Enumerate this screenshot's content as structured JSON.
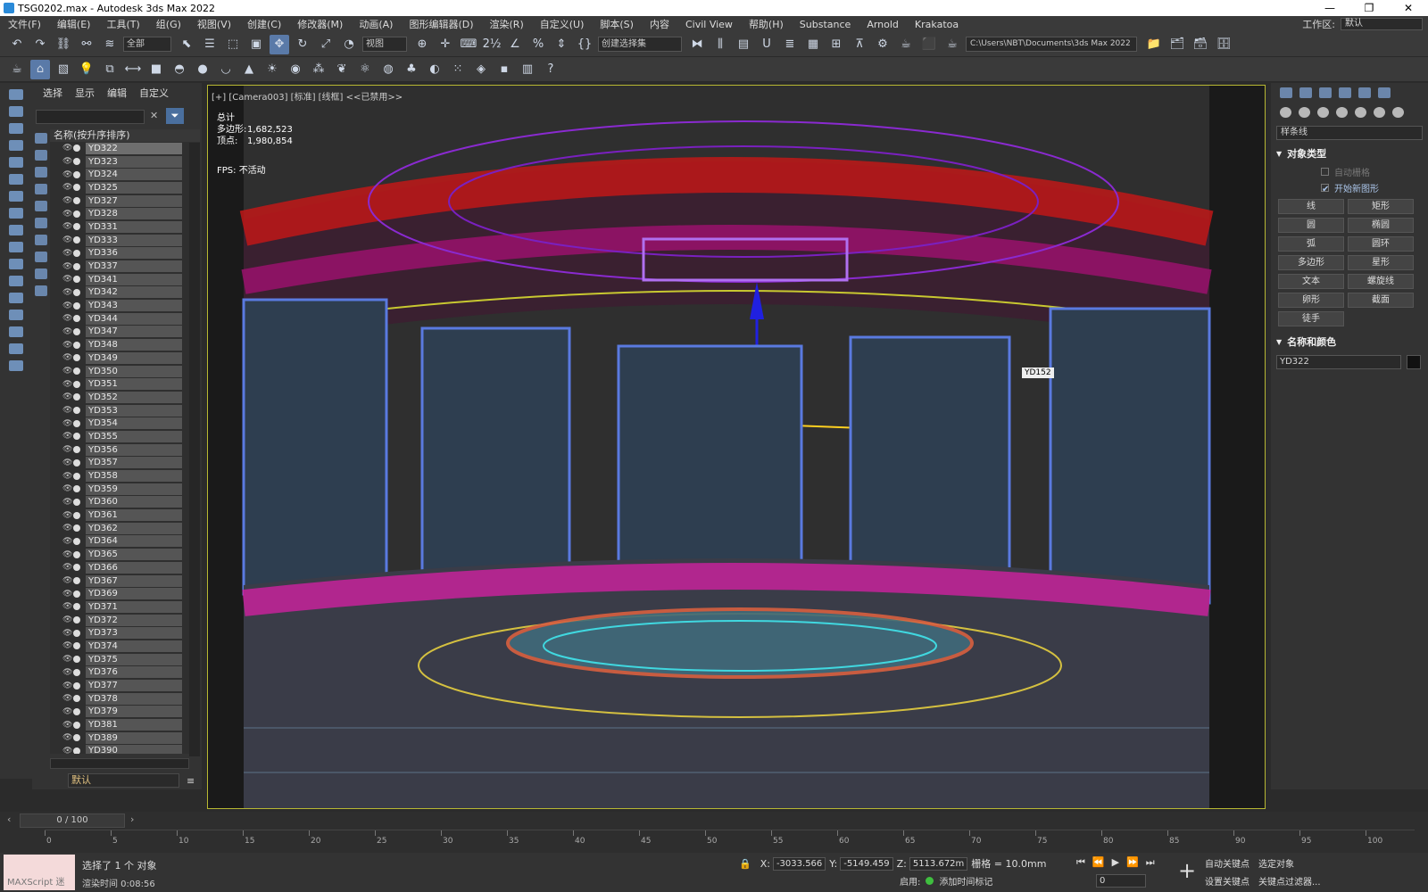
{
  "window": {
    "title": "TSG0202.max - Autodesk 3ds Max 2022",
    "minimize": "—",
    "restore": "❐",
    "close": "✕"
  },
  "menu": {
    "items": [
      "文件(F)",
      "编辑(E)",
      "工具(T)",
      "组(G)",
      "视图(V)",
      "创建(C)",
      "修改器(M)",
      "动画(A)",
      "图形编辑器(D)",
      "渲染(R)",
      "自定义(U)",
      "脚本(S)",
      "内容",
      "Civil View",
      "帮助(H)",
      "Substance",
      "Arnold",
      "Krakatoa"
    ],
    "workspace_label": "工作区:",
    "workspace_value": "默认"
  },
  "toolbar": {
    "selection_filter": "全部",
    "ref_coord": "视图",
    "named_selection": "创建选择集",
    "project_path": "C:\\Users\\NBT\\Documents\\3ds Max 2022"
  },
  "scene_explorer": {
    "tabs": [
      "选择",
      "显示",
      "编辑",
      "自定义"
    ],
    "column_header": "名称(按升序排序)",
    "items": [
      "YD322",
      "YD323",
      "YD324",
      "YD325",
      "YD327",
      "YD328",
      "YD331",
      "YD333",
      "YD336",
      "YD337",
      "YD341",
      "YD342",
      "YD343",
      "YD344",
      "YD347",
      "YD348",
      "YD349",
      "YD350",
      "YD351",
      "YD352",
      "YD353",
      "YD354",
      "YD355",
      "YD356",
      "YD357",
      "YD358",
      "YD359",
      "YD360",
      "YD361",
      "YD362",
      "YD364",
      "YD365",
      "YD366",
      "YD367",
      "YD369",
      "YD371",
      "YD372",
      "YD373",
      "YD374",
      "YD375",
      "YD376",
      "YD377",
      "YD378",
      "YD379",
      "YD381",
      "YD389",
      "YD390"
    ],
    "layer": "默认"
  },
  "viewport": {
    "label": "[+] [Camera003] [标准] [线框] <<已禁用>>",
    "stats_title": "总计",
    "polys_label": "多边形:",
    "polys_value": "1,682,523",
    "verts_label": "顶点:",
    "verts_value": "1,980,854",
    "fps_label": "FPS:",
    "fps_value": "不活动",
    "object_tag": "YD152"
  },
  "command_panel": {
    "category": "样条线",
    "object_type_title": "对象类型",
    "auto_grid": "自动栅格",
    "start_new_shape": "开始新图形",
    "buttons": [
      "线",
      "矩形",
      "圆",
      "椭圆",
      "弧",
      "圆环",
      "多边形",
      "星形",
      "文本",
      "螺旋线",
      "卵形",
      "截面",
      "徒手"
    ],
    "name_color_title": "名称和颜色",
    "object_name": "YD322"
  },
  "timeline": {
    "slider": "0 / 100",
    "ticks": [
      0,
      5,
      10,
      15,
      20,
      25,
      30,
      35,
      40,
      45,
      50,
      55,
      60,
      65,
      70,
      75,
      80,
      85,
      90,
      95,
      100
    ]
  },
  "status": {
    "maxscript": "MAXScript 迷",
    "selected": "选择了 1 个 对象",
    "render_time": "渲染时间  0:08:56",
    "x_label": "X:",
    "x_value": "-3033.566",
    "y_label": "Y:",
    "y_value": "-5149.459",
    "z_label": "Z:",
    "z_value": "5113.672m",
    "grid_label": "栅格 = 10.0mm",
    "enable_label": "启用:",
    "add_time_tag": "添加时间标记",
    "frame_value": "0",
    "auto_key": "自动关键点",
    "set_key": "设置关键点",
    "selected_object": "选定对象",
    "key_filters": "关键点过滤器..."
  }
}
